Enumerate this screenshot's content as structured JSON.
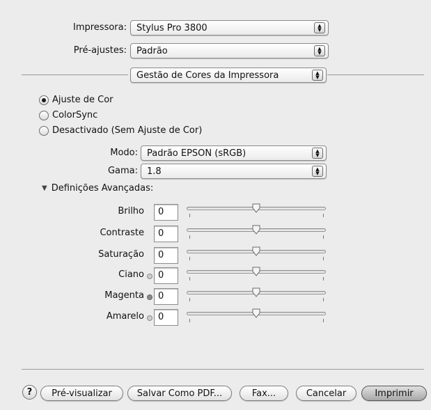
{
  "printer": {
    "label": "Impressora:",
    "value": "Stylus Pro 3800"
  },
  "presets": {
    "label": "Pré-ajustes:",
    "value": "Padrão"
  },
  "panel": {
    "value": "Gestão de Cores da Impressora"
  },
  "color_mode": {
    "options": [
      {
        "label": "Ajuste de Cor",
        "selected": true
      },
      {
        "label": "ColorSync",
        "selected": false
      },
      {
        "label": "Desactivado (Sem Ajuste de Cor)",
        "selected": false
      }
    ]
  },
  "mode": {
    "label": "Modo:",
    "value": "Padrão EPSON (sRGB)"
  },
  "gamma": {
    "label": "Gama:",
    "value": "1.8"
  },
  "advanced": {
    "label": "Definições Avançadas:",
    "expanded": true
  },
  "adjustments": [
    {
      "name": "Brilho",
      "value": "0",
      "slider_level": 0.5,
      "dot": null
    },
    {
      "name": "Contraste",
      "value": "0",
      "slider_level": 0.5,
      "dot": null
    },
    {
      "name": "Saturação",
      "value": "0",
      "slider_level": 0.5,
      "dot": null
    },
    {
      "name": "Ciano",
      "value": "0",
      "slider_level": 0.5,
      "dot": "light"
    },
    {
      "name": "Magenta",
      "value": "0",
      "slider_level": 0.5,
      "dot": "dark"
    },
    {
      "name": "Amarelo",
      "value": "0",
      "slider_level": 0.5,
      "dot": "light"
    }
  ],
  "buttons": {
    "help": "?",
    "preview": "Pré-visualizar",
    "save_pdf": "Salvar Como PDF...",
    "fax": "Fax...",
    "cancel": "Cancelar",
    "print": "Imprimir"
  }
}
